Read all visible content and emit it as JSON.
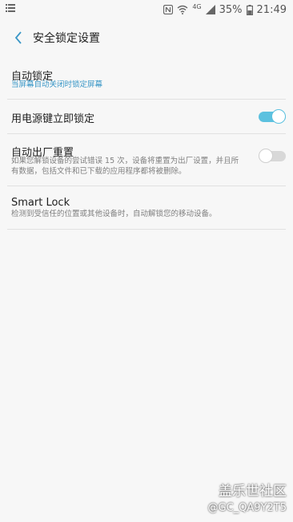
{
  "status_bar": {
    "network": "4G",
    "battery_percent": "35%",
    "time": "21:49",
    "icons": [
      "menu-icon",
      "nfc-icon",
      "wifi-icon",
      "signal-icon",
      "battery-icon"
    ]
  },
  "header": {
    "title": "安全锁定设置",
    "back_icon": "back-arrow-icon"
  },
  "settings": {
    "auto_lock": {
      "label": "自动锁定",
      "value": "当屏幕自动关闭时锁定屏幕"
    },
    "power_key_lock": {
      "label": "用电源键立即锁定",
      "enabled": true
    },
    "auto_factory_reset": {
      "label": "自动出厂重置",
      "description": "如果您解锁设备的尝试错误 15 次，设备将重置为出厂设置，并且所有数据，包括文件和已下载的应用程序都将被删除。",
      "enabled": false
    },
    "smart_lock": {
      "label": "Smart Lock",
      "description": "检测到受信任的位置或其他设备时，自动解锁您的移动设备。"
    }
  },
  "watermark": {
    "line1": "盖乐世社区",
    "line2": "@GC_QA9Y2T5"
  },
  "colors": {
    "accent": "#5cc1df",
    "link": "#3a97c7",
    "background": "#f7f7f7"
  }
}
